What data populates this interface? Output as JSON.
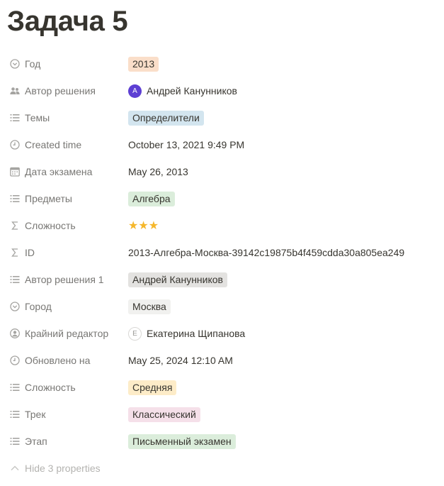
{
  "title": "Задача 5",
  "properties": [
    {
      "label": "Год",
      "icon": "select-icon",
      "type": "tag",
      "value": "2013",
      "color": "#fadec9"
    },
    {
      "label": "Автор решения",
      "icon": "people-icon",
      "type": "person",
      "value": "Андрей Канунников",
      "avatar": "A",
      "avatar_style": "filled"
    },
    {
      "label": "Темы",
      "icon": "list-icon",
      "type": "tag",
      "value": "Определители",
      "color": "#d3e5ef"
    },
    {
      "label": "Created time",
      "icon": "clock-icon",
      "type": "text",
      "value": "October 13, 2021 9:49 PM"
    },
    {
      "label": "Дата экзамена",
      "icon": "calendar-icon",
      "type": "text",
      "value": "May 26, 2013"
    },
    {
      "label": "Предметы",
      "icon": "list-icon",
      "type": "tag",
      "value": "Алгебра",
      "color": "#dbeddb"
    },
    {
      "label": "Сложность",
      "icon": "sigma-icon",
      "type": "stars",
      "value": "★★★",
      "rating": 3
    },
    {
      "label": "ID",
      "icon": "sigma-icon",
      "type": "text",
      "value": "2013-Алгебра-Москва-39142c19875b4f459cdda30a805ea249"
    },
    {
      "label": "Автор решения 1",
      "icon": "list-icon",
      "type": "tag",
      "value": "Андрей Канунников",
      "color": "#e3e2e0"
    },
    {
      "label": "Город",
      "icon": "select-icon",
      "type": "tag",
      "value": "Москва",
      "color": "#f1f1ef"
    },
    {
      "label": "Крайний редактор",
      "icon": "person-circle-icon",
      "type": "person",
      "value": "Екатерина Щипанова",
      "avatar": "E",
      "avatar_style": "outline"
    },
    {
      "label": "Обновлено на",
      "icon": "clock-icon",
      "type": "text",
      "value": "May 25, 2024 12:10 AM"
    },
    {
      "label": "Сложность",
      "icon": "list-icon",
      "type": "tag",
      "value": "Средняя",
      "color": "#fdecc8"
    },
    {
      "label": "Трек",
      "icon": "list-icon",
      "type": "tag",
      "value": "Классический",
      "color": "#f5e0e9"
    },
    {
      "label": "Этап",
      "icon": "list-icon",
      "type": "tag",
      "value": "Письменный экзамен",
      "color": "#dbeddb"
    }
  ],
  "hide_properties_label": "Hide 3 properties"
}
